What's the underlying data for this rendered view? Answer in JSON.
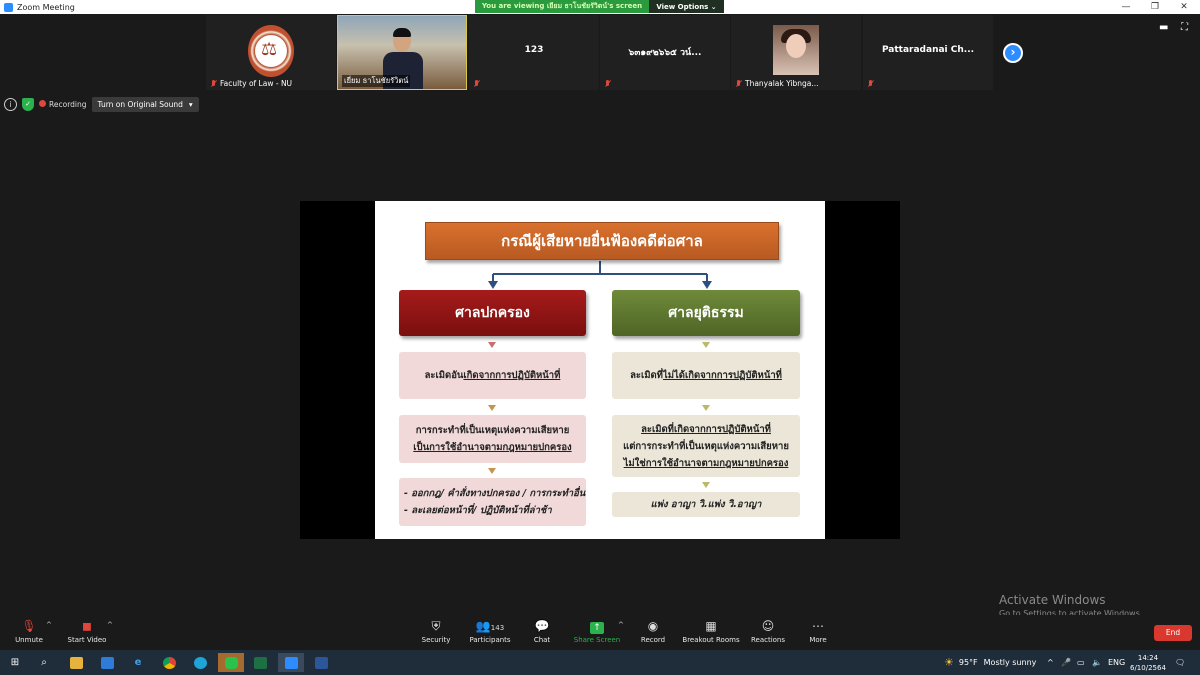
{
  "window": {
    "title": "Zoom Meeting"
  },
  "share_banner": {
    "message": "You are viewing เยียม ธาโนชัยรัวิตน์'s screen",
    "options_label": "View Options ⌄"
  },
  "participants_strip": [
    {
      "name": "Faculty of Law - NU",
      "type": "logo"
    },
    {
      "name": "เยี่ยม ธาโนชัยรัวิตน์",
      "type": "video"
    },
    {
      "name": "123",
      "type": "name-only"
    },
    {
      "name": "๖๓๑๙๒๖๖๕ วน์...",
      "type": "name-only"
    },
    {
      "name": "Thanyalak Yibnga...",
      "type": "photo"
    },
    {
      "name": "Pattaradanai  Ch...",
      "type": "name-only"
    }
  ],
  "status": {
    "recording_label": "Recording",
    "sound_button": "Turn on Original Sound"
  },
  "slide": {
    "title": "กรณีผู้เสียหายยื่นฟ้องคดีต่อศาล",
    "left": {
      "court": "ศาลปกครอง",
      "box1_pre": "ละเมิดอัน",
      "box1_u": "เกิดจากการปฏิบัติหน้าที่",
      "box2_line1": "การกระทำที่เป็นเหตุแห่งความเสียหาย",
      "box2_line2": "เป็นการใช้อำนาจตามกฎหมายปกครอง",
      "box3_line1": "- ออกกฎ/ คำสั่งทางปกครอง / การกระทำอื่น",
      "box3_line2": "- ละเลยต่อหน้าที่/ ปฏิบัติหน้าที่ล่าช้า"
    },
    "right": {
      "court": "ศาลยุติธรรม",
      "box1_pre": "ละเมิดที่",
      "box1_u": "ไม่ได้เกิดจากการปฏิบัติหน้าที่",
      "box2_line1": "ละเมิดที่เกิดจากการปฏิบัติหน้าที่",
      "box2_line2": "แต่การกระทำที่เป็นเหตุแห่งความเสียหาย",
      "box2_line3": "ไม่ใช่การใช้อำนาจตามกฎหมายปกครอง",
      "box3": "แพ่ง อาญา วิ.แพ่ง วิ.อาญา"
    }
  },
  "activate": {
    "line1": "Activate Windows",
    "line2": "Go to Settings to activate Windows."
  },
  "toolbar": {
    "unmute": "Unmute",
    "start_video": "Start Video",
    "security": "Security",
    "participants": "Participants",
    "participants_count": "143",
    "chat": "Chat",
    "share_screen": "Share Screen",
    "record": "Record",
    "breakout": "Breakout Rooms",
    "reactions": "Reactions",
    "more": "More",
    "end": "End"
  },
  "taskbar": {
    "weather_temp": "95°F",
    "weather_text": "Mostly sunny",
    "lang": "ENG",
    "time": "14:24",
    "date": "6/10/2564"
  },
  "colors": {
    "accent": "#2d8cff",
    "end": "#d8382e",
    "share_green": "#2bb24c"
  }
}
